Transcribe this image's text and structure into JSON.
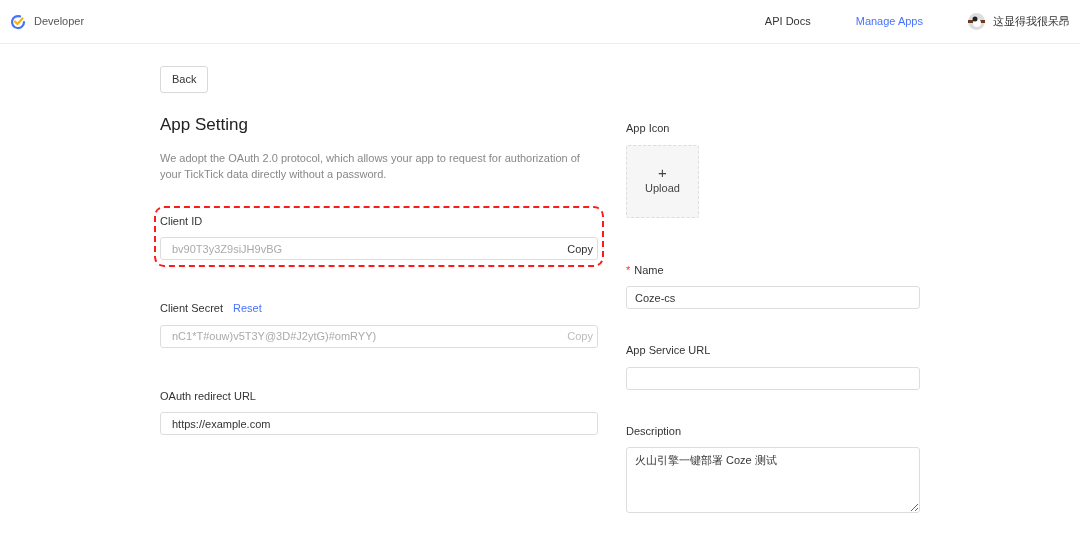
{
  "header": {
    "brand": "Developer",
    "nav": [
      {
        "label": "API Docs",
        "selected": false
      },
      {
        "label": "Manage Apps",
        "selected": true
      }
    ],
    "user": "这显得我很呆昂"
  },
  "back_button": "Back",
  "title": "App Setting",
  "intro": "We adopt the OAuth 2.0 protocol, which allows your app to request for authorization of your TickTick data directly without a password.",
  "left_fields": [
    {
      "label": "Client ID",
      "value": "bv90T3y3Z9siJH9vBG",
      "readonly": true,
      "action": "Copy",
      "action_disabled": false,
      "highlighted": true
    },
    {
      "label": "Client Secret",
      "link": "Reset",
      "value": "nC1*T#ouw)v5T3Y@3D#J2ytG)#omRYY)",
      "readonly": true,
      "action": "Copy",
      "action_disabled": true,
      "highlighted": false
    },
    {
      "label": "OAuth redirect URL",
      "value": "https://example.com",
      "readonly": false,
      "highlighted": false
    }
  ],
  "app_icon": {
    "label": "App Icon",
    "symbol": "+",
    "text": "Upload"
  },
  "required_mark": "*",
  "right_fields": [
    {
      "label": "Name",
      "required": true,
      "value": "Coze-cs",
      "kind": "input"
    },
    {
      "label": "App Service URL",
      "required": false,
      "kind": "input"
    },
    {
      "label": "Description",
      "required": false,
      "value": "火山引擎一键部署 Coze 测试",
      "kind": "textarea"
    }
  ]
}
